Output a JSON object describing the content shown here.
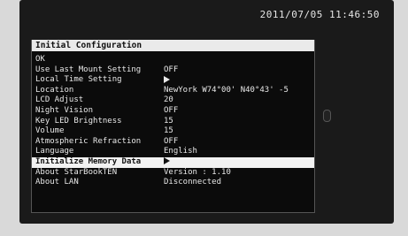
{
  "status": {
    "datetime": "2011/07/05 11:46:50"
  },
  "panel": {
    "title": "Initial Configuration",
    "items": [
      {
        "label": "OK",
        "value": ""
      },
      {
        "label": "Use Last Mount Setting",
        "value": "OFF"
      },
      {
        "label": "Local Time Setting",
        "value": "",
        "icon": "right-arrow-icon"
      },
      {
        "label": "Location",
        "value": "NewYork W74°00' N40°43' -5"
      },
      {
        "label": "LCD Adjust",
        "value": "20"
      },
      {
        "label": "Night Vision",
        "value": "OFF"
      },
      {
        "label": "Key LED Brightness",
        "value": "15"
      },
      {
        "label": "Volume",
        "value": "15"
      },
      {
        "label": "Atmospheric Refraction",
        "value": "OFF"
      },
      {
        "label": "Language",
        "value": "English"
      },
      {
        "label": "Initialize Memory Data",
        "value": "",
        "icon": "right-arrow-icon",
        "selected": true
      },
      {
        "label": "About StarBookTEN",
        "value": "Version : 1.10"
      },
      {
        "label": "About LAN",
        "value": "Disconnected"
      }
    ]
  },
  "colors": {
    "screen_bg": "#1a1a1a",
    "panel_bg": "#0b0b0b",
    "title_bg": "#eaeaea",
    "selected_bg": "#f2f2f2",
    "text": "#e8e8e8"
  }
}
